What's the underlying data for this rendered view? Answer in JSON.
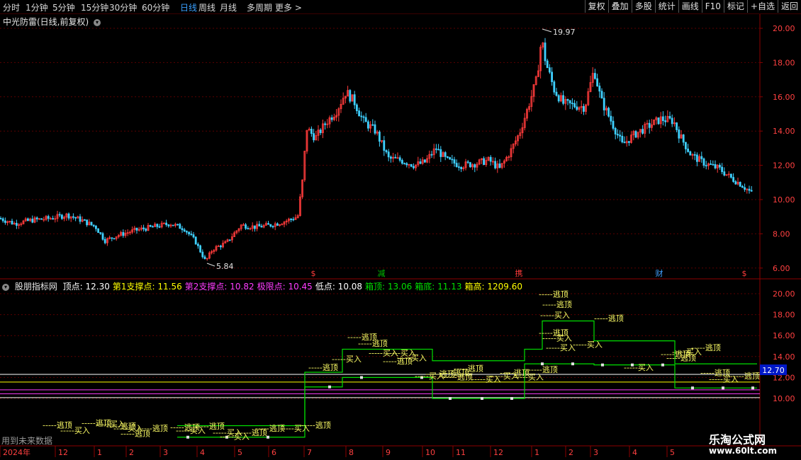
{
  "toolbar": {
    "periods": [
      "分时",
      "1分钟",
      "5分钟",
      "15分钟",
      "30分钟",
      "60分钟",
      "日线",
      "周线",
      "月线",
      "多周期",
      "更多"
    ],
    "active": "日线",
    "right_buttons": [
      "复权",
      "叠加",
      "多股",
      "统计",
      "画线",
      "F10",
      "标记",
      "+自选",
      "返回"
    ]
  },
  "main_chart": {
    "title": "中光防雷(日线,前复权)",
    "high_label": "19.97",
    "low_label": "5.84",
    "y_ticks": [
      "20.00",
      "18.00",
      "16.00",
      "14.00",
      "12.00",
      "10.00",
      "8.00",
      "6.00"
    ],
    "event_markers": [
      "$",
      "减",
      "携",
      "财",
      "$"
    ],
    "colors": {
      "up": "#ff3b3b",
      "down": "#3fd0ff",
      "grid": "#5a0000",
      "axis": "#8b0000"
    }
  },
  "indicator": {
    "name": "股朋指标网",
    "values": [
      {
        "label": "顶点:",
        "value": "12.30",
        "color": "#ffffff"
      },
      {
        "label": "第1支撑点:",
        "value": "11.56",
        "color": "#ffff00"
      },
      {
        "label": "第2支撑点:",
        "value": "10.82",
        "color": "#ff3cff"
      },
      {
        "label": "极限点:",
        "value": "10.45",
        "color": "#ff3cff"
      },
      {
        "label": "低点:",
        "value": "10.08",
        "color": "#ffffff"
      },
      {
        "label": "箱顶:",
        "value": "13.06",
        "color": "#00e000"
      },
      {
        "label": "箱底:",
        "value": "11.13",
        "color": "#00e000"
      },
      {
        "label": "箱高:",
        "value": "1209.60",
        "color": "#ffff00"
      }
    ],
    "y_ticks": [
      "20.00",
      "18.00",
      "16.00",
      "14.00",
      "12.00",
      "10.00"
    ],
    "current_price": "12.70",
    "text_sell": "逃顶",
    "text_buy": "买入"
  },
  "xaxis": {
    "labels": [
      "2024年",
      "12",
      "1",
      "2",
      "3",
      "4",
      "5",
      "6",
      "7",
      "8",
      "9",
      "10",
      "11",
      "12",
      "1",
      "2",
      "3",
      "4",
      "5"
    ]
  },
  "footer": {
    "future_note": "用到未来数据",
    "brand": "乐淘公式网",
    "url": "www.60lt.com"
  }
}
